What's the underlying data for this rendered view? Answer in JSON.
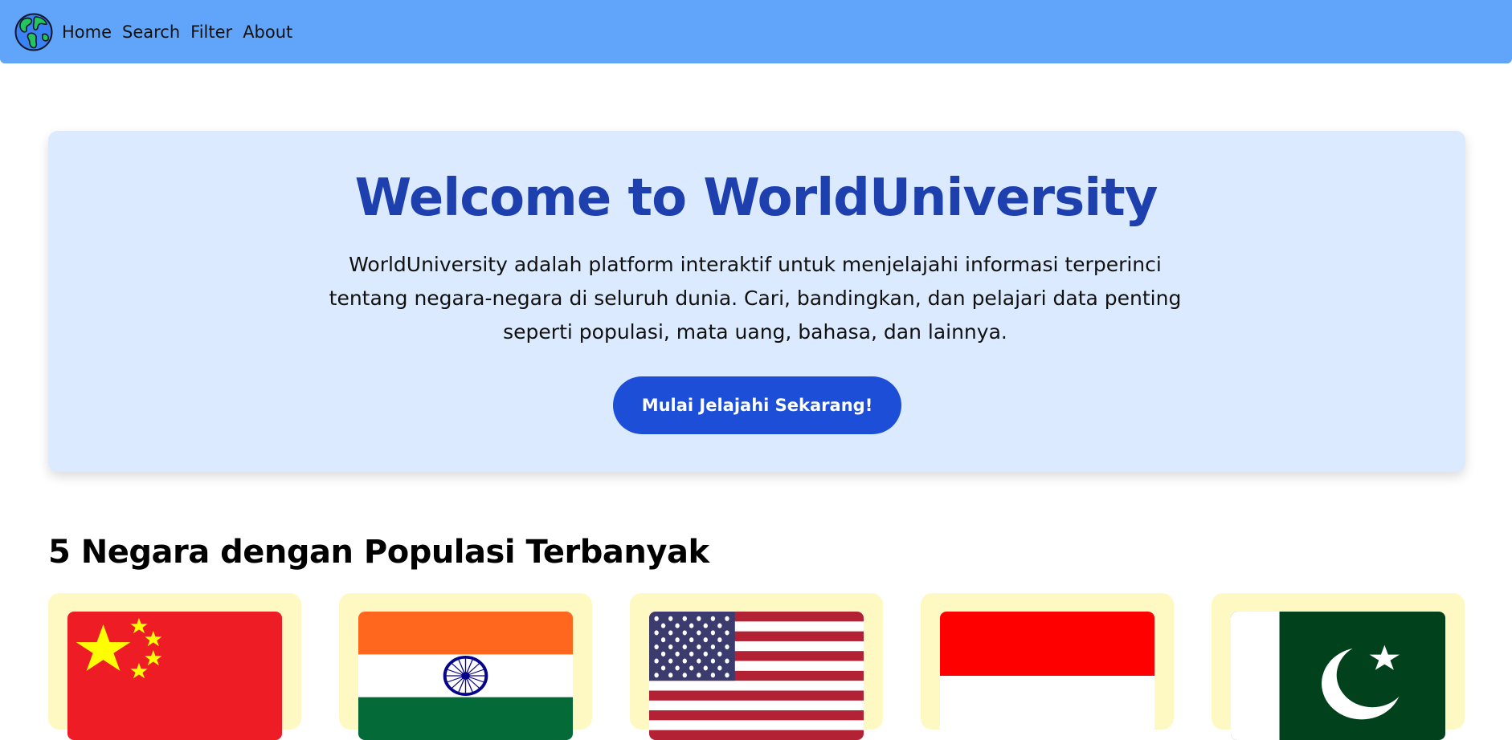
{
  "nav": {
    "logo_icon": "globe-icon",
    "links": [
      "Home",
      "Search",
      "Filter",
      "About"
    ]
  },
  "hero": {
    "title": "Welcome to WorldUniversity",
    "description": "WorldUniversity adalah platform interaktif untuk menjelajahi informasi terperinci tentang negara-negara di seluruh dunia. Cari, bandingkan, dan pelajari data penting seperti populasi, mata uang, bahasa, dan lainnya.",
    "cta_label": "Mulai Jelajahi Sekarang!"
  },
  "section": {
    "title": "5 Negara dengan Populasi Terbanyak"
  },
  "countries": [
    {
      "flag_icon": "china-flag-icon"
    },
    {
      "flag_icon": "india-flag-icon"
    },
    {
      "flag_icon": "usa-flag-icon"
    },
    {
      "flag_icon": "indonesia-flag-icon"
    },
    {
      "flag_icon": "pakistan-flag-icon"
    }
  ],
  "colors": {
    "navbar": "#60a5fa",
    "hero_bg": "#dbeafe",
    "title": "#1e40af",
    "button": "#1d4ed8",
    "card_bg": "#fef9c3"
  }
}
